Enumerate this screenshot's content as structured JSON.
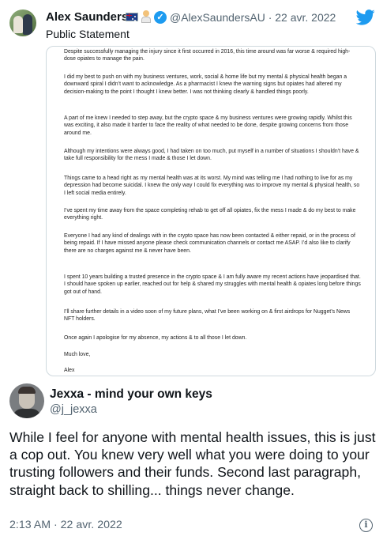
{
  "quoted_tweet": {
    "author_name": "Alex Saunders",
    "handle_date": "@AlexSaundersAU · 22 avr. 2022",
    "text": "Public Statement",
    "statement_paragraphs": [
      "Despite successfully managing the injury since it first occurred in 2016, this time around was far worse & required high-dose opiates to manage the pain.",
      "I did my best to push on with my business ventures, work, social & home life but my mental & physical health began a downward spiral I didn’t want to acknowledge. As a pharmacist I knew the warning signs but opiates had altered my decision-making to the point I thought I knew better. I was not thinking clearly & handled things poorly.",
      "A part of me knew I needed to step away, but the crypto space & my business ventures were growing rapidly. Whilst this was exciting, it also made it harder to face the reality of what needed to be done, despite growing concerns from those around me.",
      "Although my intentions were always good, I had taken on too much, put myself in a number of situations I shouldn’t have & take full responsibility for the mess I made & those I let down.",
      "Things came to a head right as my mental health was at its worst. My mind was telling me I had nothing to live for as my depression had become suicidal. I knew the only way I could fix everything was to improve my mental & physical health, so I left social media entirely.",
      "I’ve spent my time away from the space completing rehab to get off all opiates, fix the mess I made & do my best to make everything right.",
      "Everyone I had any kind of dealings with in the crypto space has now been contacted & either repaid, or in the process of being repaid. If I have missed anyone please check communication channels or contact me ASAP. I’d also like to clarify there are no charges against me & never have been.",
      "I spent 10 years building a trusted presence in the crypto space & I am fully aware my recent actions have jeopardised that. I should have spoken up earlier, reached out for help & shared my struggles with mental health & opiates long before things got out of hand.",
      "I’ll share further details in a video soon of my future plans, what I’ve been working on & first airdrops for Nugget’s News NFT holders.",
      "Once again I apologise for my absence, my actions & to all those I let down.",
      "Much love,",
      "Alex"
    ]
  },
  "reply_tweet": {
    "author_name": "Jexxa - mind your own keys",
    "handle": "@j_jexxa",
    "body": "While I feel for anyone with mental health issues, this is just a cop out. You knew very well what you were doing to your trusting followers and their funds. Second last paragraph, straight back to shilling... things never change.",
    "timestamp": "2:13 AM · 22 avr. 2022"
  },
  "icons": {
    "verified": "verified-badge-icon",
    "brand": "twitter-bird-icon",
    "info": "info-icon",
    "info_glyph": "i",
    "verified_glyph": "✓"
  },
  "colors": {
    "brand_blue": "#1d9bf0",
    "secondary_text": "#536471",
    "border": "#cfd9de"
  }
}
